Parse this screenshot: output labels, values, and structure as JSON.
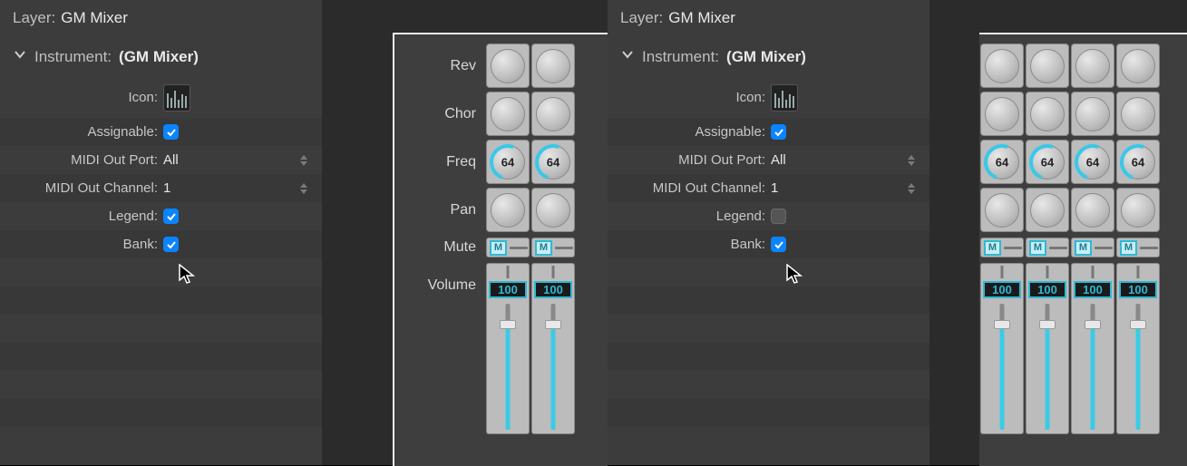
{
  "left": {
    "layer_label": "Layer:",
    "layer_value": "GM Mixer",
    "inst_label": "Instrument:",
    "inst_value": "(GM Mixer)",
    "props": {
      "icon_label": "Icon:",
      "assignable_label": "Assignable:",
      "assignable_checked": true,
      "midi_port_label": "MIDI Out Port:",
      "midi_port_value": "All",
      "midi_ch_label": "MIDI Out Channel:",
      "midi_ch_value": "1",
      "legend_label": "Legend:",
      "legend_checked": true,
      "bank_label": "Bank:",
      "bank_checked": true
    },
    "mixer": {
      "legends": {
        "rev": "Rev",
        "chor": "Chor",
        "freq": "Freq",
        "pan": "Pan",
        "mute": "Mute",
        "volume": "Volume"
      },
      "freq_values": [
        "64",
        "64"
      ],
      "mute_label": "M",
      "volume_values": [
        "100",
        "100"
      ],
      "strip_count": 2
    }
  },
  "right": {
    "layer_label": "Layer:",
    "layer_value": "GM Mixer",
    "inst_label": "Instrument:",
    "inst_value": "(GM Mixer)",
    "props": {
      "icon_label": "Icon:",
      "assignable_label": "Assignable:",
      "assignable_checked": true,
      "midi_port_label": "MIDI Out Port:",
      "midi_port_value": "All",
      "midi_ch_label": "MIDI Out Channel:",
      "midi_ch_value": "1",
      "legend_label": "Legend:",
      "legend_checked": false,
      "bank_label": "Bank:",
      "bank_checked": true
    },
    "mixer": {
      "freq_values": [
        "64",
        "64",
        "64",
        "64"
      ],
      "mute_label": "M",
      "volume_values": [
        "100",
        "100",
        "100",
        "100"
      ],
      "strip_count": 4
    }
  }
}
